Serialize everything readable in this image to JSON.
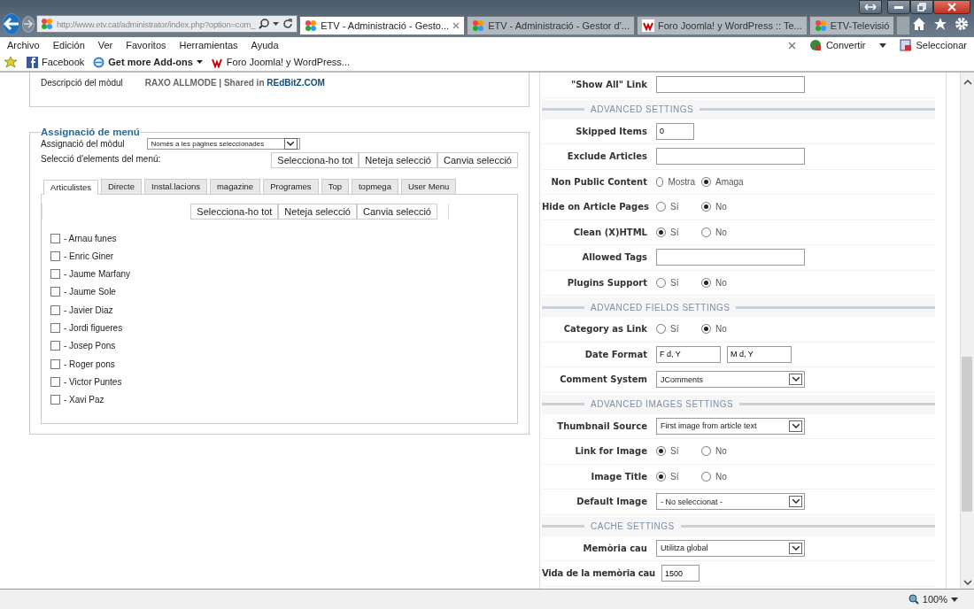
{
  "browser": {
    "address": "http://www.etv.cat/administrator/index.php?option=com_",
    "tabs": [
      {
        "label": "ETV - Administració - Gesto...",
        "selected": true,
        "kind": "joomla"
      },
      {
        "label": "ETV - Administració - Gestor d'...",
        "selected": false,
        "kind": "joomla"
      },
      {
        "label": "Foro Joomla! y WordPress :: Te...",
        "selected": false,
        "kind": "foro"
      },
      {
        "label": "ETV-Televisió",
        "selected": false,
        "kind": "joomla"
      }
    ],
    "menu": [
      "Archivo",
      "Edición",
      "Ver",
      "Favoritos",
      "Herramientas",
      "Ayuda"
    ],
    "toolbar_actions": [
      "Convertir",
      "Seleccionar"
    ],
    "favorites": [
      {
        "label": "Facebook",
        "kind": "facebook"
      },
      {
        "label": "Get more Add-ons",
        "kind": "addons"
      },
      {
        "label": "Foro Joomla! y WordPress...",
        "kind": "foro"
      }
    ],
    "zoom": "100%"
  },
  "details": {
    "label": "Descripció del mòdul",
    "value": "RAXO ALLMODE | Shared in ",
    "link": "REdBitZ.COM"
  },
  "menu_assignment": {
    "title": "Assignació de menú",
    "assignment_label": "Assignació del mòdul",
    "assignment_value": "Només a les pàgines seleccionades",
    "selection_label": "Selecció d'elements del menú:",
    "buttons": [
      "Selecciona-ho tot",
      "Neteja selecció",
      "Canvia selecció"
    ],
    "tabs": [
      {
        "label": "Articulistes",
        "selected": true
      },
      {
        "label": "Directe",
        "selected": false
      },
      {
        "label": "Instal.lacions",
        "selected": false
      },
      {
        "label": "magazine",
        "selected": false
      },
      {
        "label": "Programes",
        "selected": false
      },
      {
        "label": "Top",
        "selected": false
      },
      {
        "label": "topmega",
        "selected": false
      },
      {
        "label": "User Menu",
        "selected": false
      }
    ],
    "inner_buttons": [
      "Selecciona-ho tot",
      "Neteja selecció",
      "Canvia selecció"
    ],
    "items": [
      {
        "label": "- Arnau funes",
        "checked": false
      },
      {
        "label": "- Enric Giner",
        "checked": false
      },
      {
        "label": "- Jaume Marfany",
        "checked": false
      },
      {
        "label": "- Jaume Sole",
        "checked": false
      },
      {
        "label": "- Javier Diaz",
        "checked": false
      },
      {
        "label": "- Jordi figueres",
        "checked": false
      },
      {
        "label": "- Josep Pons",
        "checked": false
      },
      {
        "label": "- Roger pons",
        "checked": false
      },
      {
        "label": "- Victor Puntes",
        "checked": false
      },
      {
        "label": "- Xavi Paz",
        "checked": false
      }
    ]
  },
  "settings": [
    {
      "kind": "text",
      "label": "\"Show All\" Link",
      "wide": true
    },
    {
      "kind": "section",
      "label": "ADVANCED SETTINGS"
    },
    {
      "kind": "text",
      "label": "Skipped Items",
      "value": "0",
      "wide": false
    },
    {
      "kind": "text",
      "label": "Exclude Articles",
      "wide": true
    },
    {
      "kind": "radio",
      "label": "Non Public Content",
      "options": [
        {
          "label": "Mostra",
          "selected": false
        },
        {
          "label": "Amaga",
          "selected": true
        }
      ]
    },
    {
      "kind": "radio",
      "label": "Hide on Article Pages",
      "options": [
        {
          "label": "Sí",
          "selected": false
        },
        {
          "label": "No",
          "selected": true
        }
      ]
    },
    {
      "kind": "radio",
      "label": "Clean (X)HTML",
      "options": [
        {
          "label": "Sí",
          "selected": true
        },
        {
          "label": "No",
          "selected": false
        }
      ]
    },
    {
      "kind": "text",
      "label": "Allowed Tags",
      "wide": true
    },
    {
      "kind": "radio",
      "label": "Plugins Support",
      "options": [
        {
          "label": "Sí",
          "selected": false
        },
        {
          "label": "No",
          "selected": true
        }
      ]
    },
    {
      "kind": "section",
      "label": "ADVANCED FIELDS SETTINGS"
    },
    {
      "kind": "radio",
      "label": "Category as Link",
      "options": [
        {
          "label": "Sí",
          "selected": false
        },
        {
          "label": "No",
          "selected": true
        }
      ]
    },
    {
      "kind": "dates",
      "label": "Date Format",
      "values": [
        "F d, Y",
        "M d, Y"
      ]
    },
    {
      "kind": "select",
      "label": "Comment System",
      "value": "JComments"
    },
    {
      "kind": "section",
      "label": "ADVANCED IMAGES SETTINGS"
    },
    {
      "kind": "select",
      "label": "Thumbnail Source",
      "value": "First image from article text"
    },
    {
      "kind": "radio",
      "label": "Link for Image",
      "options": [
        {
          "label": "Sí",
          "selected": true
        },
        {
          "label": "No",
          "selected": false
        }
      ]
    },
    {
      "kind": "radio",
      "label": "Image Title",
      "options": [
        {
          "label": "Sí",
          "selected": true
        },
        {
          "label": "No",
          "selected": false
        }
      ]
    },
    {
      "kind": "select",
      "label": "Default Image",
      "value": "- No seleccionat -"
    },
    {
      "kind": "section",
      "label": "CACHE SETTINGS"
    },
    {
      "kind": "select",
      "label": "Memòria cau",
      "value": "Utilitza global"
    },
    {
      "kind": "text",
      "label": "Vida de la memòria cau",
      "value": "1500",
      "wide": false
    }
  ]
}
